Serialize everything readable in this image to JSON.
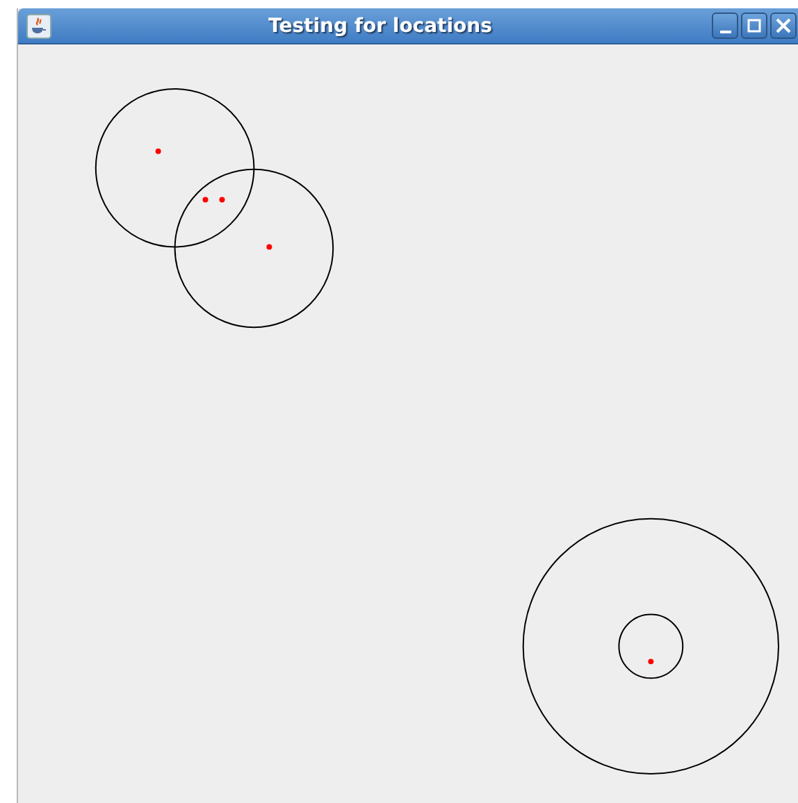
{
  "window": {
    "title": "Testing for locations"
  }
}
